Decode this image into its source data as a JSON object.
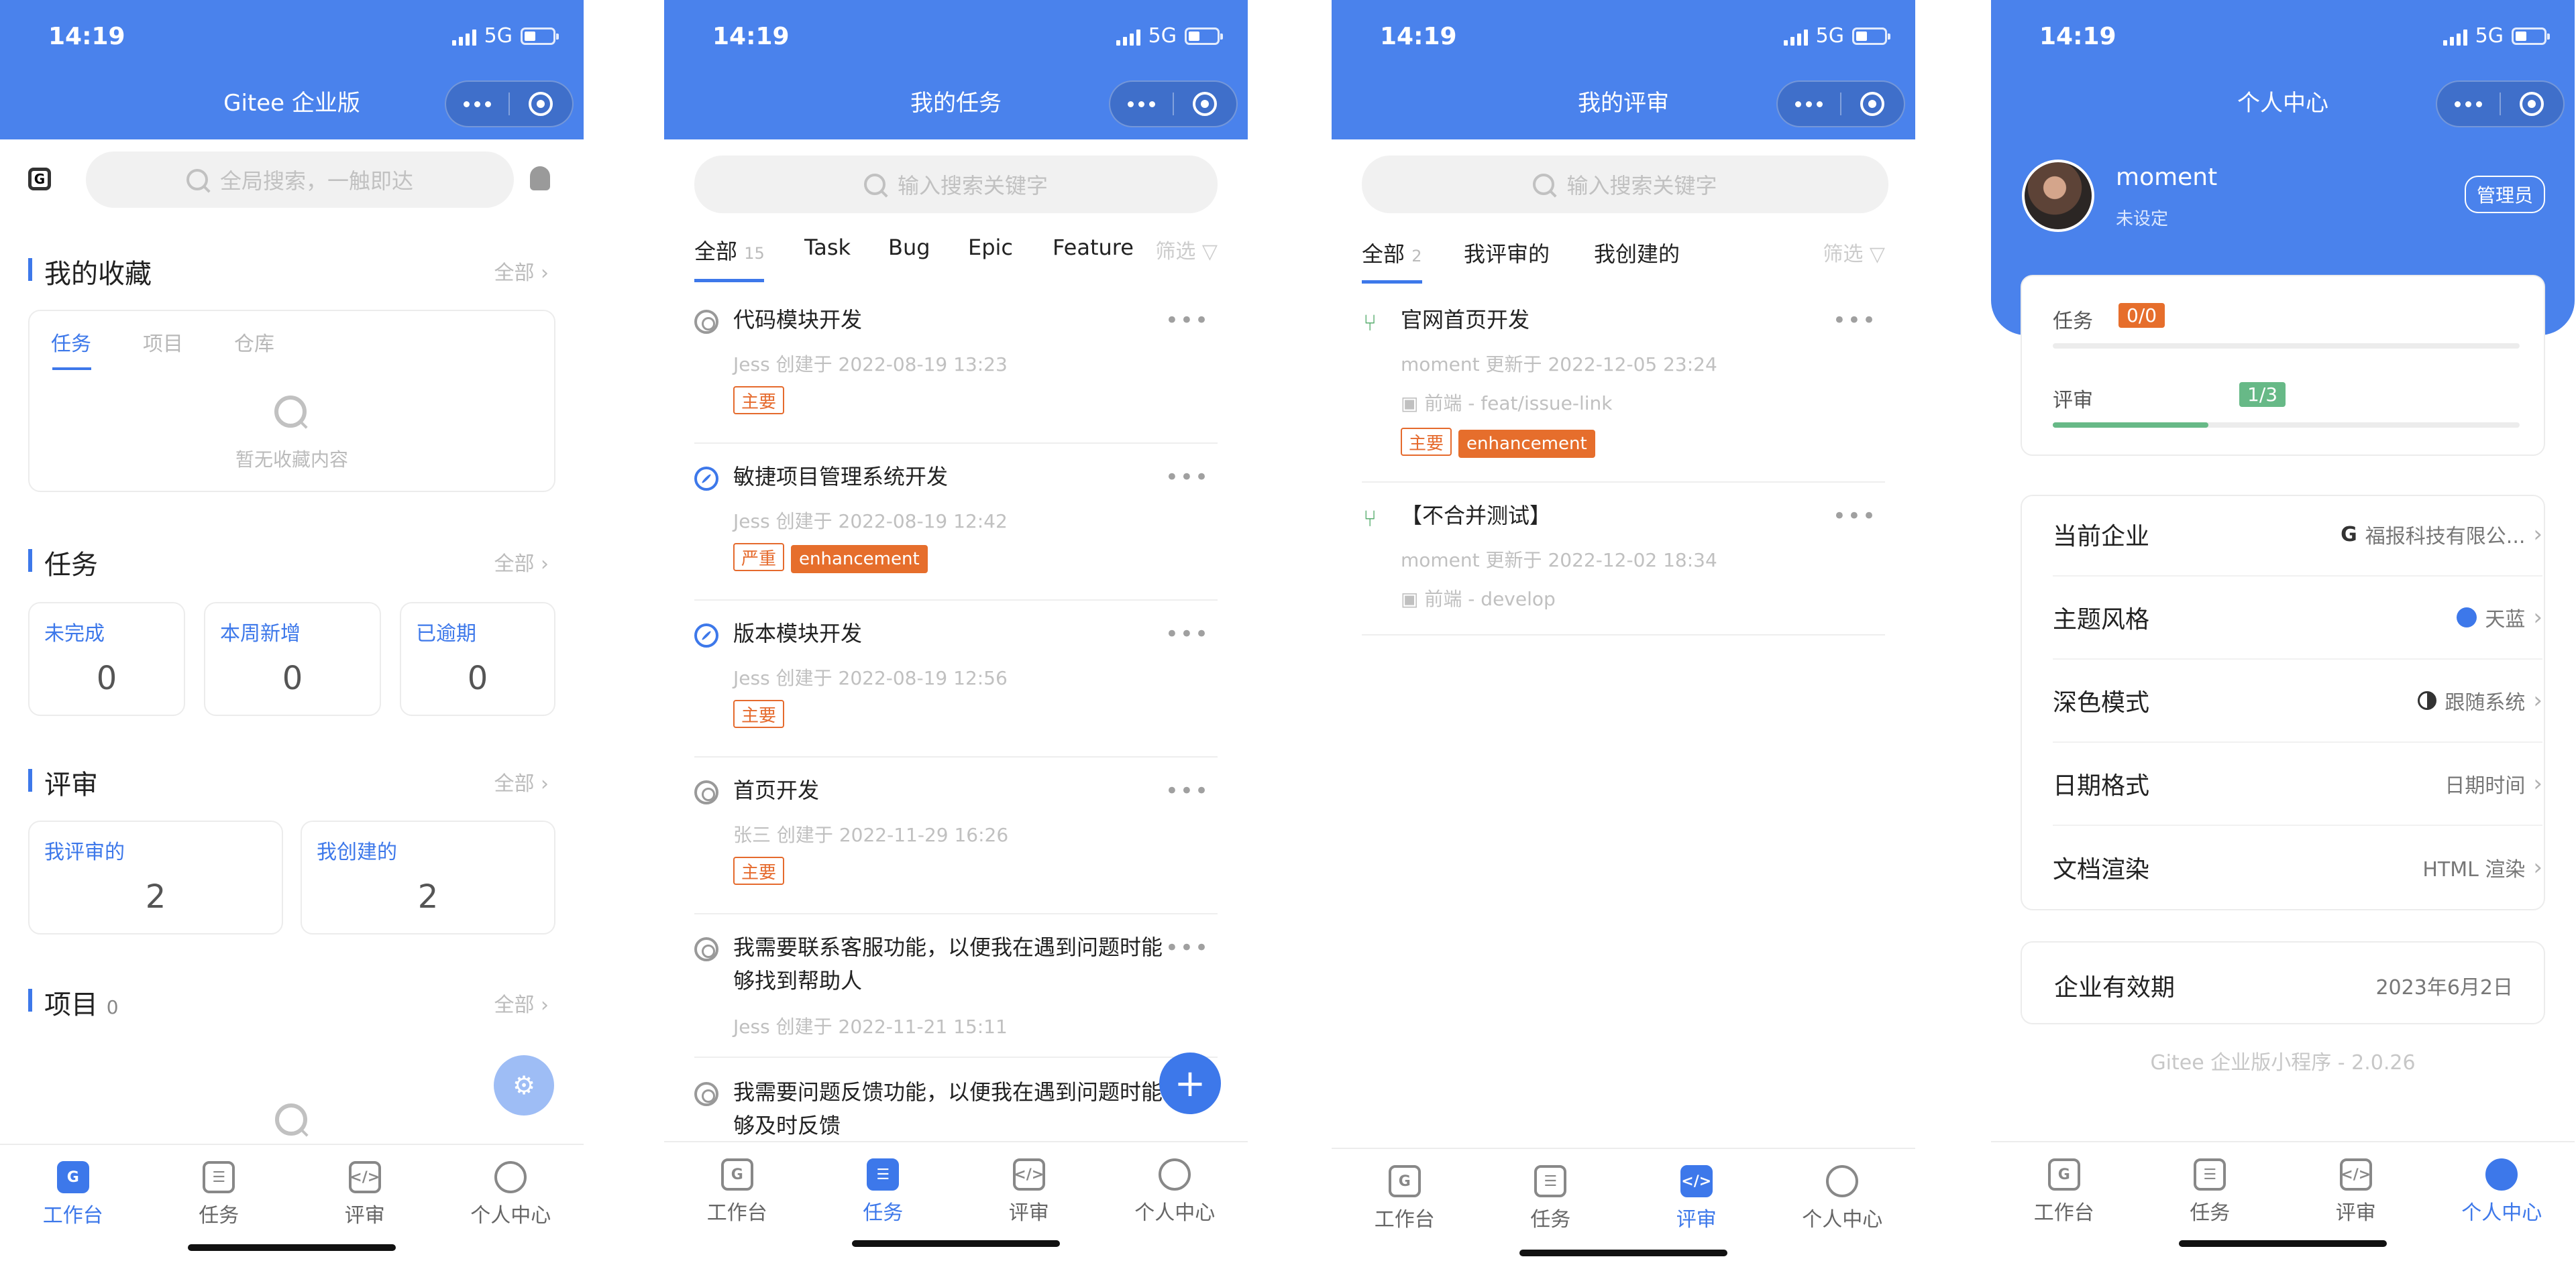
{
  "status": {
    "time": "14:19",
    "network": "5G"
  },
  "navbar": {
    "more_dots": "•••"
  },
  "tabbar": [
    "工作台",
    "任务",
    "评审",
    "个人中心"
  ],
  "workspace": {
    "title": "Gitee 企业版",
    "search_placeholder": "全局搜索，一触即达",
    "favorites": {
      "title": "我的收藏",
      "all": "全部",
      "tabs": [
        "任务",
        "项目",
        "仓库"
      ],
      "empty": "暂无收藏内容"
    },
    "tasks": {
      "title": "任务",
      "all": "全部",
      "items": [
        {
          "label": "未完成",
          "count": "0"
        },
        {
          "label": "本周新增",
          "count": "0"
        },
        {
          "label": "已逾期",
          "count": "0"
        }
      ]
    },
    "reviews": {
      "title": "评审",
      "all": "全部",
      "items": [
        {
          "label": "我评审的",
          "count": "2"
        },
        {
          "label": "我创建的",
          "count": "2"
        }
      ]
    },
    "projects": {
      "title": "项目",
      "count": "0",
      "all": "全部"
    }
  },
  "my_tasks": {
    "title": "我的任务",
    "search_placeholder": "输入搜索关键字",
    "tabs": [
      {
        "label": "全部",
        "count": "15"
      },
      {
        "label": "Task"
      },
      {
        "label": "Bug"
      },
      {
        "label": "Epic"
      },
      {
        "label": "Feature"
      }
    ],
    "filter": "筛选",
    "items": [
      {
        "icon": "circle-icon",
        "title": "代码模块开发",
        "author": "Jess",
        "created_label": "创建于",
        "created_at": "2022-08-19 13:23",
        "tags": [
          "主要"
        ]
      },
      {
        "icon": "wrench-icon",
        "title": "敏捷项目管理系统开发",
        "author": "Jess",
        "created_label": "创建于",
        "created_at": "2022-08-19 12:42",
        "tags": [
          "严重",
          "enhancement"
        ]
      },
      {
        "icon": "wrench-icon",
        "title": "版本模块开发",
        "author": "Jess",
        "created_label": "创建于",
        "created_at": "2022-08-19 12:56",
        "tags": [
          "主要"
        ]
      },
      {
        "icon": "circle-icon",
        "title": "首页开发",
        "author": "张三",
        "created_label": "创建于",
        "created_at": "2022-11-29 16:26",
        "tags": [
          "主要"
        ]
      },
      {
        "icon": "circle-icon",
        "title": "我需要联系客服功能，以便我在遇到问题时能够找到帮助人",
        "author": "Jess",
        "created_label": "创建于",
        "created_at": "2022-11-21 15:11",
        "tags": []
      },
      {
        "icon": "circle-icon",
        "title": "我需要问题反馈功能，以便我在遇到问题时能够及时反馈",
        "author": "",
        "created_label": "",
        "created_at": "",
        "tags": []
      }
    ]
  },
  "reviews_page": {
    "title": "我的评审",
    "search_placeholder": "输入搜索关键字",
    "tabs": [
      {
        "label": "全部",
        "count": "2"
      },
      {
        "label": "我评审的"
      },
      {
        "label": "我创建的"
      }
    ],
    "filter": "筛选",
    "items": [
      {
        "title": "官网首页开发",
        "author": "moment",
        "updated_label": "更新于",
        "updated_at": "2022-12-05 23:24",
        "repo": "前端",
        "branch": "feat/issue-link",
        "tags": [
          "主要",
          "enhancement"
        ]
      },
      {
        "title": "【不合并测试】",
        "author": "moment",
        "updated_label": "更新于",
        "updated_at": "2022-12-02 18:34",
        "repo": "前端",
        "branch": "develop",
        "tags": []
      }
    ]
  },
  "profile": {
    "title": "个人中心",
    "name": "moment",
    "subtitle": "未设定",
    "role": "管理员",
    "progress": [
      {
        "label": "任务",
        "value": "0/0",
        "fraction": 0
      },
      {
        "label": "评审",
        "value": "1/3",
        "fraction": 0.333
      }
    ],
    "settings": [
      {
        "label": "当前企业",
        "value": "福报科技有限公..."
      },
      {
        "label": "主题风格",
        "value": "天蓝"
      },
      {
        "label": "深色模式",
        "value": "跟随系统"
      },
      {
        "label": "日期格式",
        "value": "日期时间"
      },
      {
        "label": "文档渲染",
        "value": "HTML 渲染"
      }
    ],
    "enterprise_validity": {
      "label": "企业有效期",
      "value": "2023年6月2日"
    },
    "version": "Gitee 企业版小程序 - 2.0.26"
  },
  "colors": {
    "primary": "#4a82ec",
    "accent": "#3d78ea",
    "tag_orange": "#e66e2c",
    "progress_green": "#67b987"
  }
}
